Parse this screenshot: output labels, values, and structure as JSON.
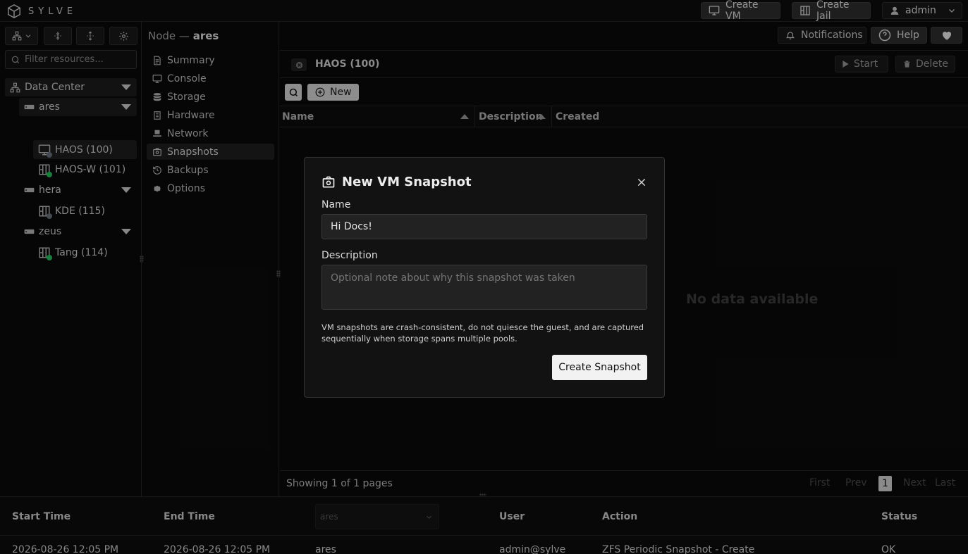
{
  "brand": {
    "name": "SYLVE"
  },
  "topbar": {
    "create_vm": "Create VM",
    "create_jail": "Create Jail",
    "user": "admin",
    "notifications": "Notifications",
    "help": "Help"
  },
  "sidebar": {
    "filter_placeholder": "Filter resources...",
    "tree": {
      "datacenter": "Data Center",
      "nodes": [
        {
          "name": "ares",
          "children": [
            {
              "label": "HAOS (100)",
              "kind": "vm",
              "status": "stopped"
            },
            {
              "label": "HAOS-W (101)",
              "kind": "jail",
              "status": "running"
            }
          ]
        },
        {
          "name": "hera",
          "children": [
            {
              "label": "KDE (115)",
              "kind": "jail",
              "status": "stopped"
            }
          ]
        },
        {
          "name": "zeus",
          "children": [
            {
              "label": "Tang (114)",
              "kind": "jail",
              "status": "running"
            }
          ]
        }
      ]
    }
  },
  "breadcrumb": {
    "prefix": "Node —",
    "node": "ares"
  },
  "nav": {
    "items": [
      "Summary",
      "Console",
      "Storage",
      "Hardware",
      "Network",
      "Snapshots",
      "Backups",
      "Options"
    ],
    "active": "Snapshots"
  },
  "vm": {
    "title": "HAOS (100)",
    "start": "Start",
    "delete": "Delete",
    "new": "New"
  },
  "table": {
    "columns": [
      "Name",
      "Description",
      "Created"
    ],
    "empty": "No data available",
    "pagination": {
      "summary": "Showing 1 of 1 pages",
      "first": "First",
      "prev": "Prev",
      "current": "1",
      "next": "Next",
      "last": "Last"
    }
  },
  "log": {
    "columns": [
      "Start Time",
      "End Time",
      "User",
      "Action",
      "Status"
    ],
    "node_filter": "ares",
    "row": {
      "start": "2026-08-26 12:05 PM",
      "end": "2026-08-26 12:05 PM",
      "node": "ares",
      "user": "admin@sylve",
      "action": "ZFS Periodic Snapshot - Create",
      "status": "OK"
    }
  },
  "modal": {
    "title": "New VM Snapshot",
    "name_label": "Name",
    "name_value": "Hi Docs!",
    "description_label": "Description",
    "description_placeholder": "Optional note about why this snapshot was taken",
    "note": "VM snapshots are crash-consistent, do not quiesce the guest, and are captured sequentially when storage spans multiple pools.",
    "create_button": "Create Snapshot"
  },
  "colors": {
    "running": "#22c55e",
    "stopped": "#6b7280",
    "accent": "#f2f2f2"
  }
}
